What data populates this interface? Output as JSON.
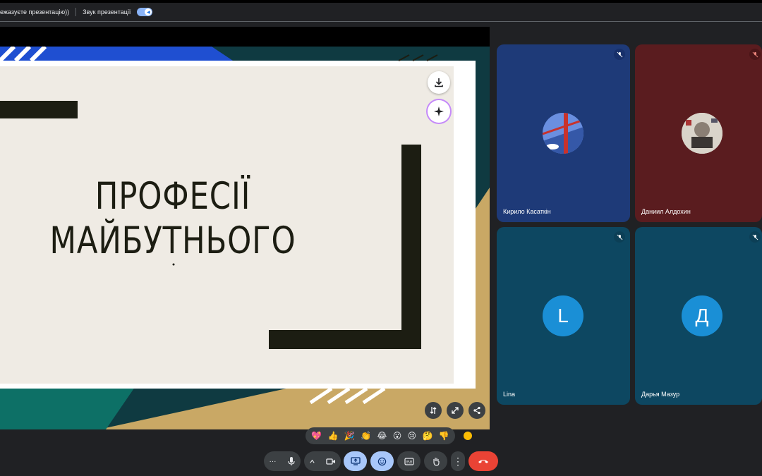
{
  "topbar": {
    "presenting_text": "ежазуєте презентацію))",
    "audio_label": "Звук презентації"
  },
  "slide": {
    "title_line1": "ПРОФЕСІЇ",
    "title_line2": "МАЙБУТНЬОГО"
  },
  "slide_buttons": [
    "download-icon",
    "sparkle-icon"
  ],
  "stage_controls": [
    "swap-icon",
    "fullscreen-icon",
    "share-icon"
  ],
  "participants": [
    {
      "name": "Кирило Касаткін",
      "avatar": "photo-bridge",
      "color": "#1e3a78",
      "muted": true
    },
    {
      "name": "Даниил Алдохин",
      "avatar": "photo-collage",
      "color": "#5a1c1f",
      "muted": true
    },
    {
      "name": "Lina",
      "avatar_letter": "L",
      "color": "#0d4761",
      "muted": true
    },
    {
      "name": "Дарья Мазур",
      "avatar_letter": "Д",
      "color": "#0d4761",
      "muted": true
    }
  ],
  "reactions": [
    "💖",
    "👍",
    "🎉",
    "👏",
    "😂",
    "😮",
    "😢",
    "🤔",
    "👎"
  ],
  "controls": [
    "more-options-icon",
    "microphone-icon",
    "chevron-up-icon",
    "camera-icon",
    "present-icon",
    "emoji-icon",
    "captions-icon",
    "raise-hand-icon",
    "more-vert-icon",
    "end-call-icon"
  ],
  "colors": {
    "accent": "#8ab4f8",
    "end_call": "#ea4335",
    "active_control": "#a8c7fa"
  }
}
